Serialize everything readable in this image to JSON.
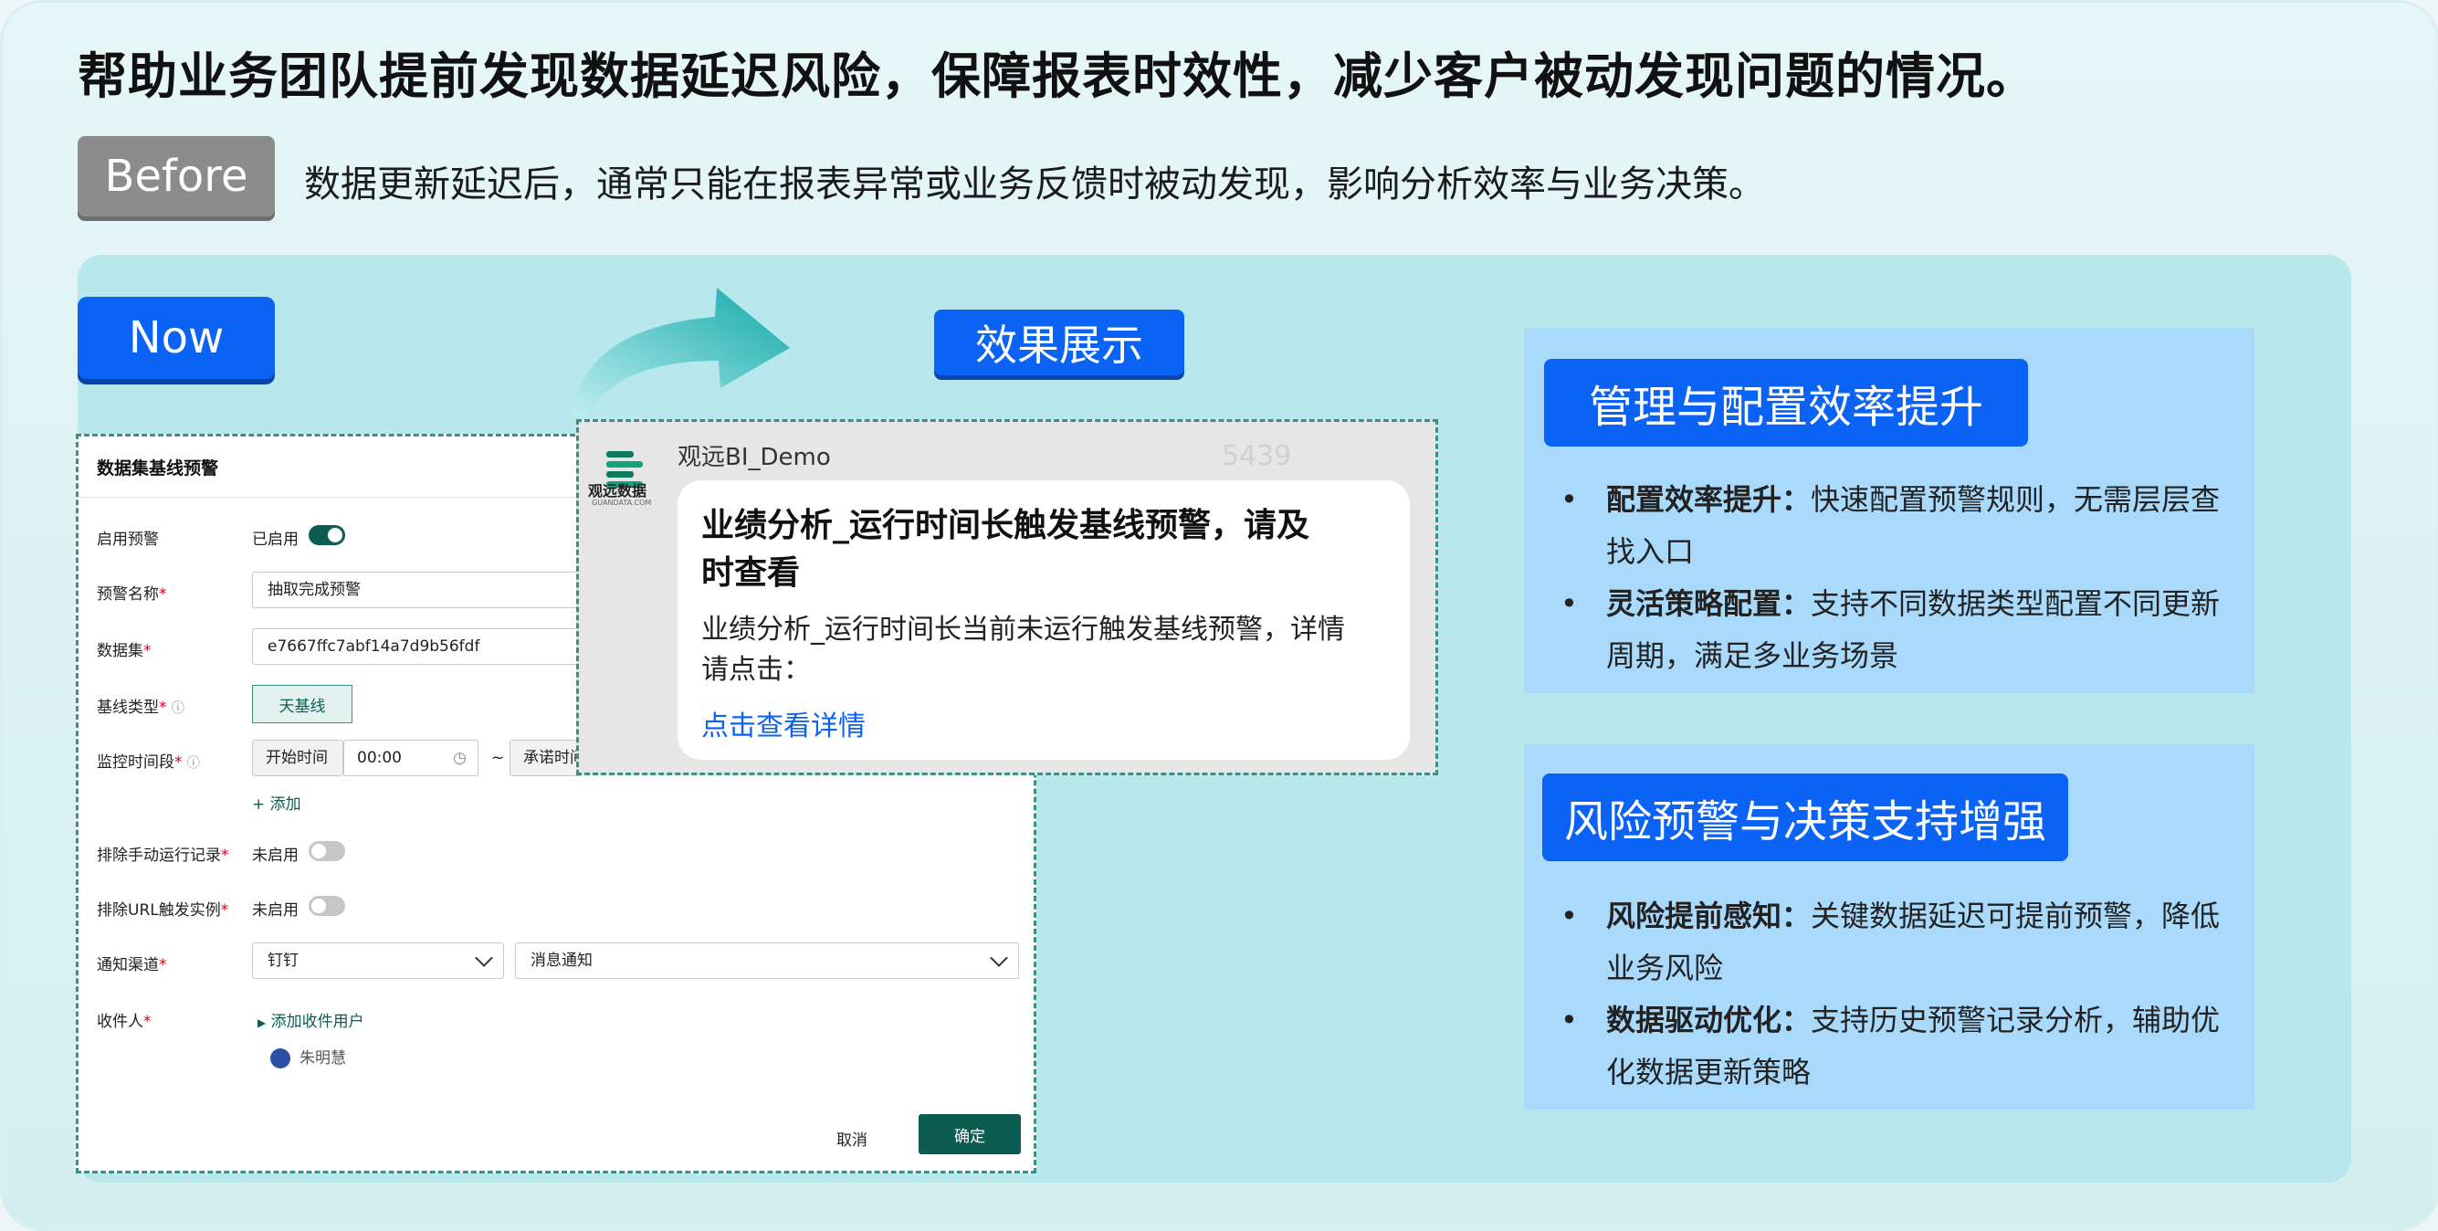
{
  "headline": "帮助业务团队提前发现数据延迟风险，保障报表时效性，减少客户被动发现问题的情况。",
  "before": {
    "label": "Before",
    "text": "数据更新延迟后，通常只能在报表异常或业务反馈时被动发现，影响分析效率与业务决策。"
  },
  "now": {
    "label": "Now"
  },
  "effect": {
    "label": "效果展示"
  },
  "form": {
    "title": "数据集基线预警",
    "enable": {
      "label": "启用预警",
      "value": "已启用"
    },
    "name": {
      "label": "预警名称",
      "value": "抽取完成预警"
    },
    "dataset": {
      "label": "数据集",
      "value": "e7667ffc7abf14a7d9b56fdf"
    },
    "baseline_type": {
      "label": "基线类型",
      "option": "天基线"
    },
    "monitor": {
      "label": "监控时间段",
      "start_label": "开始时间",
      "start_value": "00:00",
      "tilde": "~",
      "end_label": "承诺时间"
    },
    "add_label": "+ 添加",
    "exclude_manual": {
      "label": "排除手动运行记录",
      "value": "未启用"
    },
    "exclude_url": {
      "label": "排除URL触发实例",
      "value": "未启用"
    },
    "channel": {
      "label": "通知渠道",
      "value1": "钉钉",
      "value2": "消息通知"
    },
    "recipient": {
      "label": "收件人",
      "add_user": "添加收件用户",
      "user": "朱明慧"
    },
    "cancel": "取消",
    "ok": "确定",
    "required_mark": "*"
  },
  "notification": {
    "brand": "观远数据",
    "brand_sub": "GUANDATA.COM",
    "sender": "观远BI_Demo",
    "watermark": "5439",
    "title": "业绩分析_运行时间长触发基线预警，请及时查看",
    "body": "业绩分析_运行时间长当前未运行触发基线预警，详情请点击：",
    "link": "点击查看详情"
  },
  "box1": {
    "heading": "管理与配置效率提升",
    "items": [
      {
        "bold": "配置效率提升：",
        "text": "快速配置预警规则，无需层层查找入口"
      },
      {
        "bold": "灵活策略配置：",
        "text": "支持不同数据类型配置不同更新周期，满足多业务场景"
      }
    ]
  },
  "box2": {
    "heading": "风险预警与决策支持增强",
    "items": [
      {
        "bold": "风险提前感知：",
        "text": "关键数据延迟可提前预警，降低业务风险"
      },
      {
        "bold": "数据驱动优化：",
        "text": "支持历史预警记录分析，辅助优化数据更新策略"
      }
    ]
  },
  "bullet_glyph": "•",
  "colors": {
    "accent_blue": "#0a63f5",
    "form_green": "#0d5c52",
    "panel": "#b9e8ec",
    "box": "#a9dafb",
    "before_gray": "#8c8c8c"
  }
}
